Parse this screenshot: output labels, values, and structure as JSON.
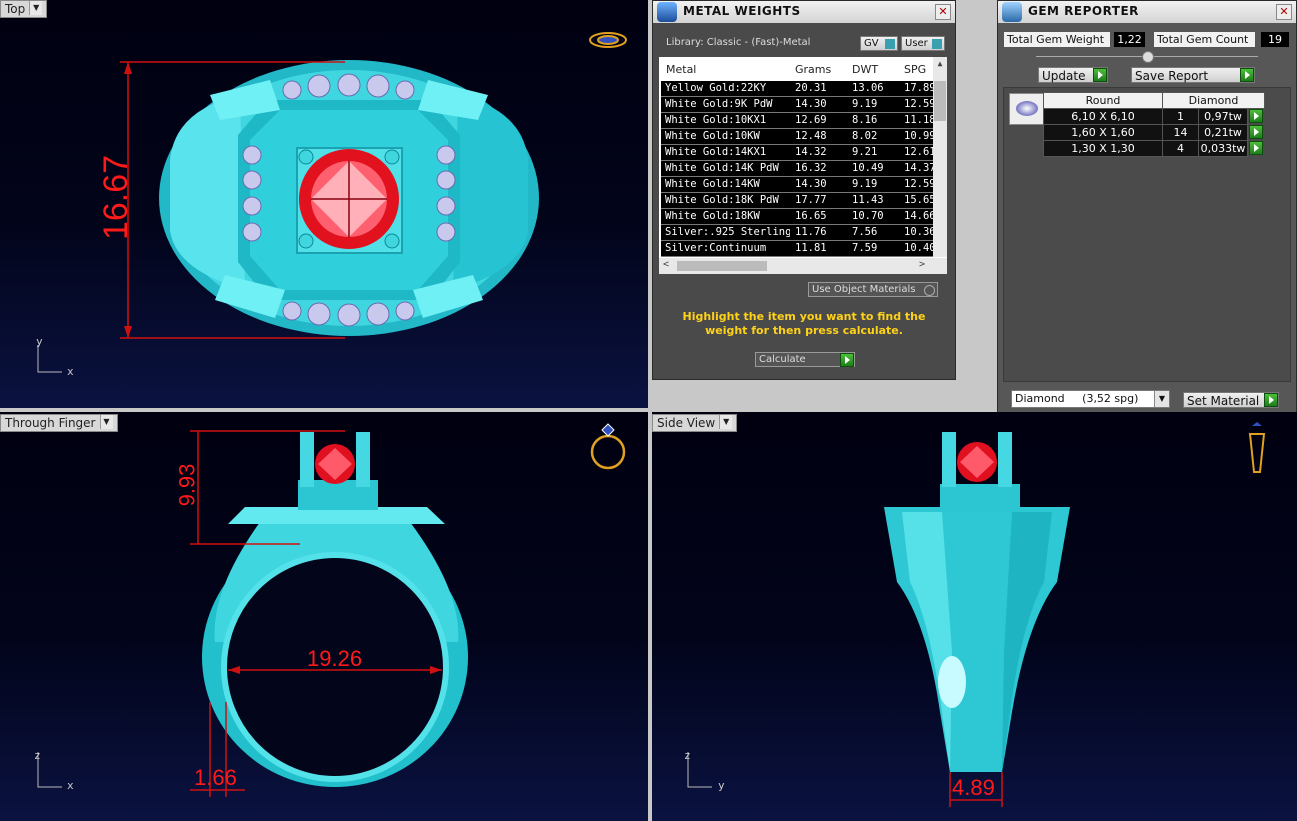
{
  "viewports": {
    "top": {
      "label": "Top",
      "dimension": "16.67",
      "axis_v": "y",
      "axis_h": "x"
    },
    "through_finger": {
      "label": "Through Finger",
      "dim_height": "9.93",
      "dim_width": "19.26",
      "dim_thickness": "1.66",
      "axis_v": "z",
      "axis_h": "x"
    },
    "side_view": {
      "label": "Side View",
      "dim_width": "4.89",
      "axis_v": "z",
      "axis_h": "y"
    }
  },
  "metal_weights": {
    "title": "METAL WEIGHTS",
    "library": "Library: Classic - (Fast)-Metal",
    "gv_label": "GV",
    "user_label": "User",
    "columns": [
      "Metal",
      "Grams",
      "DWT",
      "SPG"
    ],
    "rows": [
      [
        "Yellow Gold:22KY",
        "20.31",
        "13.06",
        "17.89"
      ],
      [
        "White Gold:9K PdW",
        "14.30",
        "9.19",
        "12.59"
      ],
      [
        "White Gold:10KX1",
        "12.69",
        "8.16",
        "11.18"
      ],
      [
        "White Gold:10KW",
        "12.48",
        "8.02",
        "10.99"
      ],
      [
        "White Gold:14KX1",
        "14.32",
        "9.21",
        "12.61"
      ],
      [
        "White Gold:14K PdW",
        "16.32",
        "10.49",
        "14.37"
      ],
      [
        "White Gold:14KW",
        "14.30",
        "9.19",
        "12.59"
      ],
      [
        "White Gold:18K PdW",
        "17.77",
        "11.43",
        "15.65"
      ],
      [
        "White Gold:18KW",
        "16.65",
        "10.70",
        "14.66"
      ],
      [
        "Silver:.925 Sterling",
        "11.76",
        "7.56",
        "10.36"
      ],
      [
        "Silver:Continuum",
        "11.81",
        "7.59",
        "10.40"
      ]
    ],
    "use_object_materials": "Use Object Materials",
    "hint": "Highlight the item you want to find the weight for then press calculate.",
    "calculate_label": "Calculate"
  },
  "gem_reporter": {
    "title": "GEM REPORTER",
    "total_weight_label": "Total Gem Weight",
    "total_weight_value": "1,22",
    "total_count_label": "Total Gem Count",
    "total_count_value": "19",
    "update_label": "Update",
    "save_report_label": "Save Report",
    "shape": "Round",
    "material": "Diamond",
    "gems": [
      {
        "size": "6,10 X 6,10",
        "count": "1",
        "weight": "0,97tw"
      },
      {
        "size": "1,60 X 1,60",
        "count": "14",
        "weight": "0,21tw"
      },
      {
        "size": "1,30 X 1,30",
        "count": "4",
        "weight": "0,033tw"
      }
    ],
    "material_select": "Diamond     (3,52 spg)",
    "set_material_label": "Set Material"
  }
}
